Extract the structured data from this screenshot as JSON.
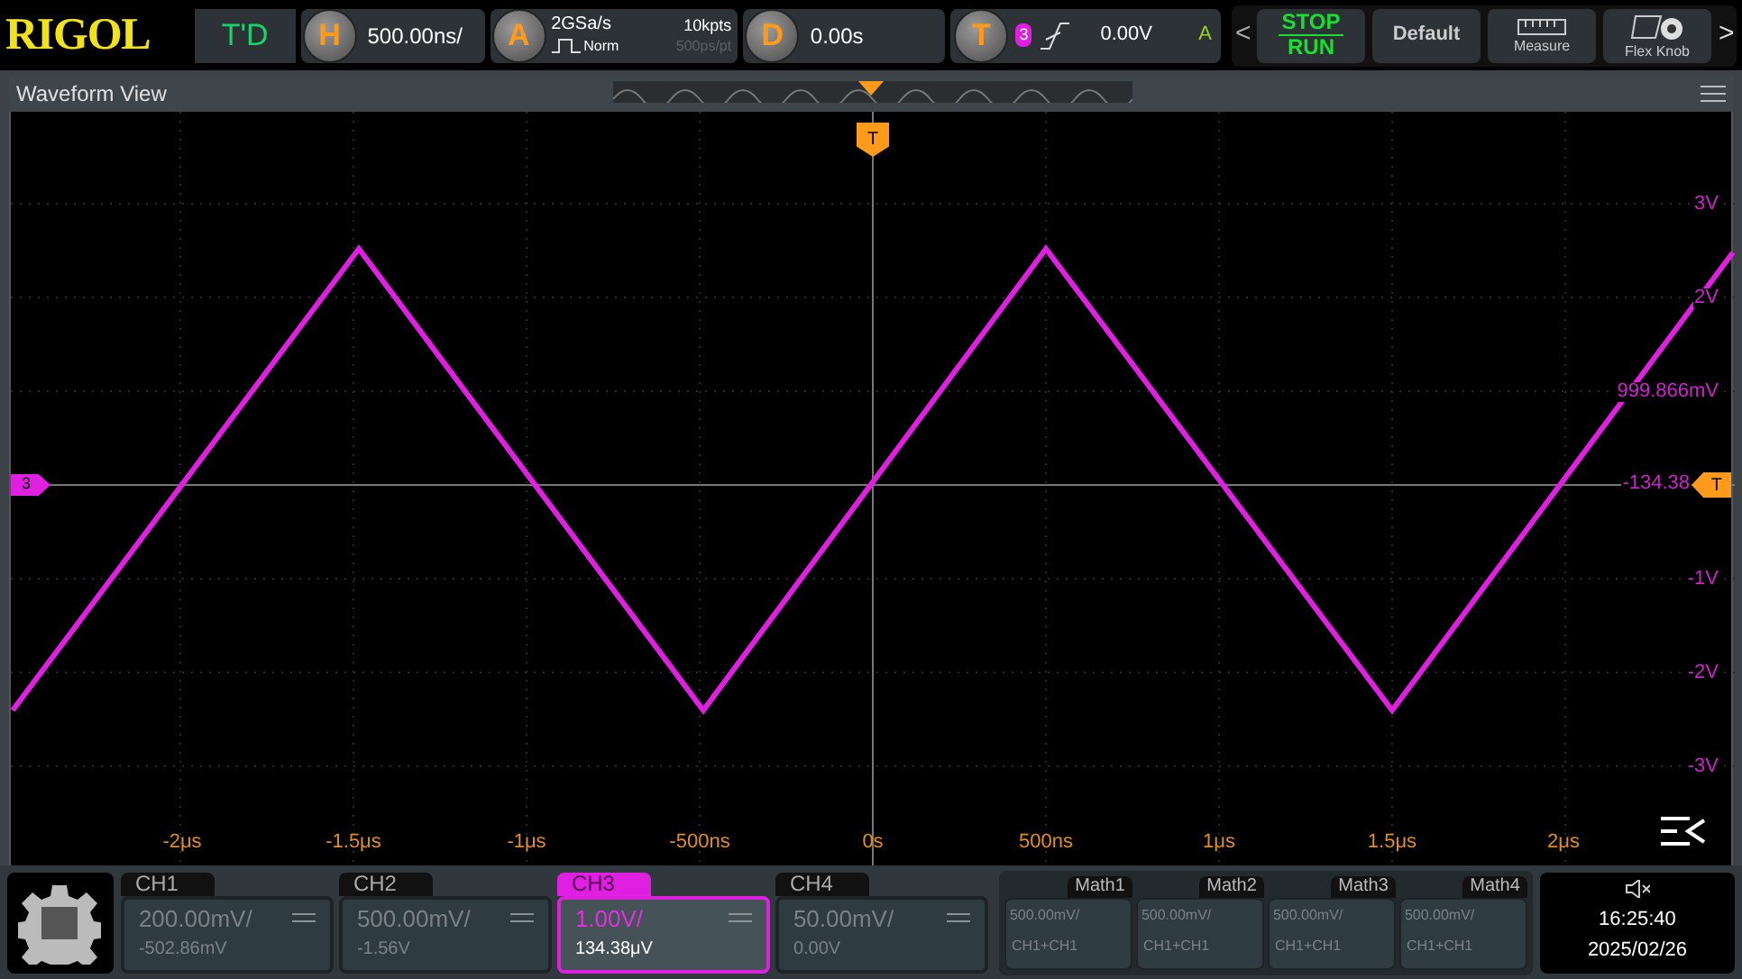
{
  "brand": "RIGOL",
  "mode": "T'D",
  "horizontal": {
    "label": "H",
    "scale": "500.00ns/"
  },
  "acquire": {
    "label": "A",
    "sample_rate": "2GSa/s",
    "memory": "10kpts",
    "mode": "Norm",
    "resolution": "500ps/pt"
  },
  "delay": {
    "label": "D",
    "value": "0.00s"
  },
  "trigger": {
    "label": "T",
    "source": "3",
    "level": "0.00V",
    "sweep": "A"
  },
  "toolbar": {
    "prev": "<",
    "stop": "STOP",
    "run": "RUN",
    "next": ">",
    "buttons": [
      {
        "label": "Default",
        "kind": "default"
      },
      {
        "label": "Measure",
        "kind": "measure"
      },
      {
        "label": "Flex Knob",
        "kind": "knob"
      }
    ]
  },
  "waveform_view": {
    "title": "Waveform View",
    "trigger_marker": "T",
    "channel_marker": "3",
    "level_marker": "T",
    "y_labels": [
      "3V",
      "2V",
      "999.866mV",
      "-134.38",
      "-1V",
      "-2V",
      "-3V"
    ],
    "x_labels": [
      "-2μs",
      "-1.5μs",
      "-1μs",
      "-500ns",
      "0s",
      "500ns",
      "1μs",
      "1.5μs",
      "2μs"
    ]
  },
  "channels": [
    {
      "name": "CH1",
      "scale": "200.00mV/",
      "offset": "-502.86mV",
      "selected": false
    },
    {
      "name": "CH2",
      "scale": "500.00mV/",
      "offset": "-1.56V",
      "selected": false
    },
    {
      "name": "CH3",
      "scale": "1.00V/",
      "offset": "134.38μV",
      "selected": true
    },
    {
      "name": "CH4",
      "scale": "50.00mV/",
      "offset": "0.00V",
      "selected": false
    }
  ],
  "math": [
    {
      "name": "Math1",
      "scale": "500.00mV/",
      "source": "CH1+CH1"
    },
    {
      "name": "Math2",
      "scale": "500.00mV/",
      "source": "CH1+CH1"
    },
    {
      "name": "Math3",
      "scale": "500.00mV/",
      "source": "CH1+CH1"
    },
    {
      "name": "Math4",
      "scale": "500.00mV/",
      "source": "CH1+CH1"
    }
  ],
  "status": {
    "time": "16:25:40",
    "date": "2025/02/26"
  }
}
